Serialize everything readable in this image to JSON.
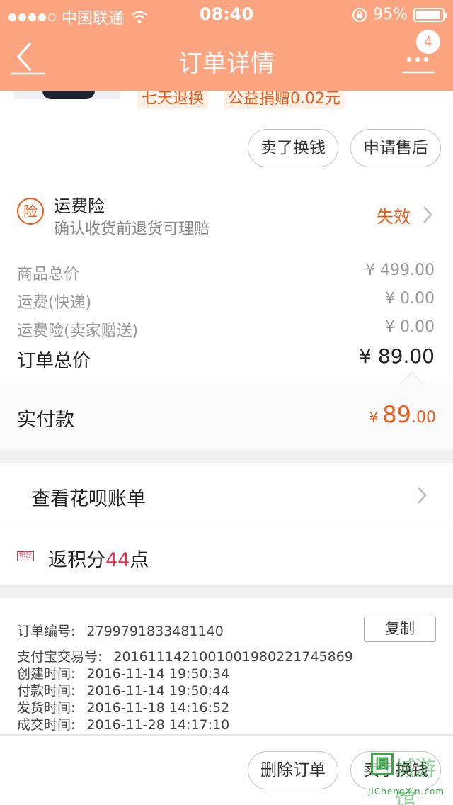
{
  "status_bar": {
    "carrier": "中国联通",
    "time": "08:40",
    "battery": "95%",
    "battery_level": 0.95,
    "signal_bars": 4
  },
  "navbar": {
    "title": "订单详情",
    "badge": "4"
  },
  "item": {
    "tag_return": "七天退换",
    "tag_donation": "公益捐赠0.02元",
    "sell_button": "卖了换钱",
    "after_sale_button": "申请售后"
  },
  "insurance": {
    "icon_char": "险",
    "title": "运费险",
    "subtitle": "确认收货前退货可理赔",
    "status": "失效"
  },
  "price": {
    "rows": [
      {
        "label": "商品总价",
        "value": "¥ 499.00"
      },
      {
        "label": "运费(快递)",
        "value": "¥ 0.00"
      },
      {
        "label": "运费险(卖家赠送)",
        "value": "¥ 0.00"
      }
    ],
    "total_label": "订单总价",
    "total_value": "¥ 89.00",
    "paid_label": "实付款",
    "paid_currency": "¥",
    "paid_int": "89",
    "paid_dec": ".00"
  },
  "huabei": {
    "label": "查看花呗账单"
  },
  "points": {
    "icon_text": "积分",
    "prefix": "返积分",
    "number": "44",
    "suffix": "点"
  },
  "order_info": {
    "rows": [
      {
        "label": "订单编号:",
        "value": "2799791833481140"
      },
      {
        "label": "支付宝交易号:",
        "value": "2016111421001001980221745869"
      },
      {
        "label": "创建时间:",
        "value": "2016-11-14 19:50:34"
      },
      {
        "label": "付款时间:",
        "value": "2016-11-14 19:50:44"
      },
      {
        "label": "发货时间:",
        "value": "2016-11-18 14:16:52"
      },
      {
        "label": "成交时间:",
        "value": "2016-11-28 14:17:10"
      }
    ],
    "copy_button": "复制",
    "delete_button": "删除订单",
    "sell_button": "卖了换钱"
  },
  "watermark": {
    "box_char": "圜",
    "name": "城游馆",
    "url": "JiChengXin.com"
  },
  "colors": {
    "header": "#fba47f",
    "accent_orange": "#e95c1a",
    "points_red": "#e0314b"
  }
}
